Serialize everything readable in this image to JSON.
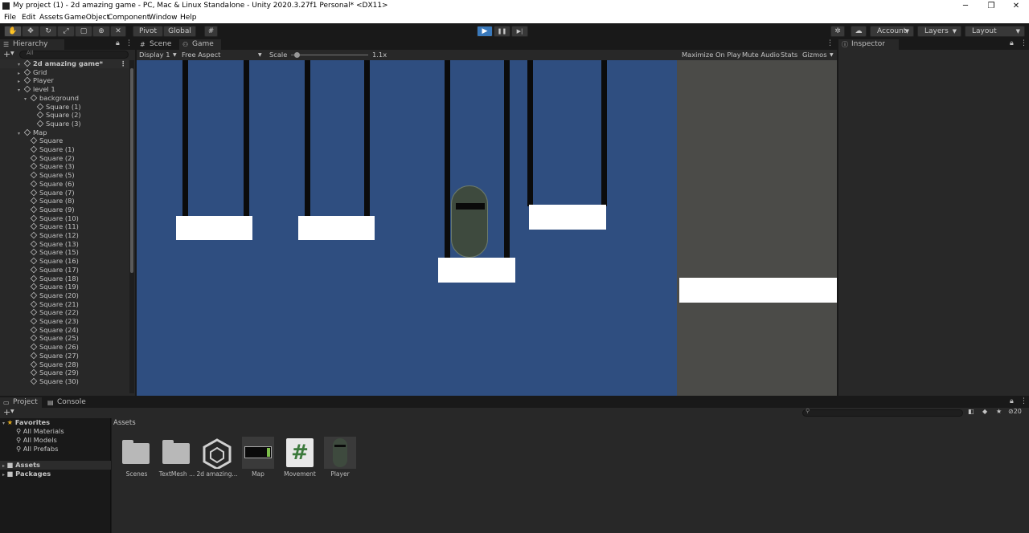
{
  "window": {
    "title": "My project (1) - 2d amazing game - PC, Mac & Linux Standalone - Unity 2020.3.27f1 Personal* <DX11>",
    "minimize": "─",
    "maximize": "❐",
    "close": "✕"
  },
  "menu": [
    "File",
    "Edit",
    "Assets",
    "GameObject",
    "Component",
    "Window",
    "Help"
  ],
  "toolbar": {
    "pivot": "Pivot",
    "global": "Global",
    "play": "▶",
    "pause": "❚❚",
    "step": "▶|",
    "account": "Account",
    "layers": "Layers",
    "layout": "Layout"
  },
  "hierarchy": {
    "tab": "Hierarchy",
    "search_placeholder": "All",
    "scene": "2d amazing game*",
    "items": [
      {
        "label": "Grid",
        "depth": 1,
        "arrow": "▸"
      },
      {
        "label": "Player",
        "depth": 1,
        "arrow": "▸"
      },
      {
        "label": "level 1",
        "depth": 1,
        "arrow": "▾"
      },
      {
        "label": "background",
        "depth": 2,
        "arrow": "▾"
      },
      {
        "label": "Square (1)",
        "depth": 3,
        "arrow": ""
      },
      {
        "label": "Square (2)",
        "depth": 3,
        "arrow": ""
      },
      {
        "label": "Square (3)",
        "depth": 3,
        "arrow": ""
      },
      {
        "label": "Map",
        "depth": 1,
        "arrow": "▾"
      },
      {
        "label": "Square",
        "depth": 2,
        "arrow": ""
      },
      {
        "label": "Square (1)",
        "depth": 2,
        "arrow": ""
      },
      {
        "label": "Square (2)",
        "depth": 2,
        "arrow": ""
      },
      {
        "label": "Square (3)",
        "depth": 2,
        "arrow": ""
      },
      {
        "label": "Square (5)",
        "depth": 2,
        "arrow": ""
      },
      {
        "label": "Square (6)",
        "depth": 2,
        "arrow": ""
      },
      {
        "label": "Square (7)",
        "depth": 2,
        "arrow": ""
      },
      {
        "label": "Square (8)",
        "depth": 2,
        "arrow": ""
      },
      {
        "label": "Square (9)",
        "depth": 2,
        "arrow": ""
      },
      {
        "label": "Square (10)",
        "depth": 2,
        "arrow": ""
      },
      {
        "label": "Square (11)",
        "depth": 2,
        "arrow": ""
      },
      {
        "label": "Square (12)",
        "depth": 2,
        "arrow": ""
      },
      {
        "label": "Square (13)",
        "depth": 2,
        "arrow": ""
      },
      {
        "label": "Square (15)",
        "depth": 2,
        "arrow": ""
      },
      {
        "label": "Square (16)",
        "depth": 2,
        "arrow": ""
      },
      {
        "label": "Square (17)",
        "depth": 2,
        "arrow": ""
      },
      {
        "label": "Square (18)",
        "depth": 2,
        "arrow": ""
      },
      {
        "label": "Square (19)",
        "depth": 2,
        "arrow": ""
      },
      {
        "label": "Square (20)",
        "depth": 2,
        "arrow": ""
      },
      {
        "label": "Square (21)",
        "depth": 2,
        "arrow": ""
      },
      {
        "label": "Square (22)",
        "depth": 2,
        "arrow": ""
      },
      {
        "label": "Square (23)",
        "depth": 2,
        "arrow": ""
      },
      {
        "label": "Square (24)",
        "depth": 2,
        "arrow": ""
      },
      {
        "label": "Square (25)",
        "depth": 2,
        "arrow": ""
      },
      {
        "label": "Square (26)",
        "depth": 2,
        "arrow": ""
      },
      {
        "label": "Square (27)",
        "depth": 2,
        "arrow": ""
      },
      {
        "label": "Square (28)",
        "depth": 2,
        "arrow": ""
      },
      {
        "label": "Square (29)",
        "depth": 2,
        "arrow": ""
      },
      {
        "label": "Square (30)",
        "depth": 2,
        "arrow": ""
      }
    ]
  },
  "center": {
    "tabs": [
      "Scene",
      "Game"
    ],
    "display": "Display 1",
    "aspect": "Free Aspect",
    "scale_label": "Scale",
    "scale_value": "1.1x",
    "maximize": "Maximize On Play",
    "mute": "Mute Audio",
    "stats": "Stats",
    "gizmos": "Gizmos"
  },
  "inspector": {
    "tab": "Inspector"
  },
  "bottom": {
    "tabs": [
      "Project",
      "Console"
    ],
    "favorites": "Favorites",
    "favorite_items": [
      "All Materials",
      "All Models",
      "All Prefabs"
    ],
    "roots": [
      "Assets",
      "Packages"
    ],
    "assets_header": "Assets",
    "hidden_count": "20",
    "assets": [
      {
        "label": "Scenes",
        "icon": "folder-icon"
      },
      {
        "label": "TextMesh ...",
        "icon": "folder-icon"
      },
      {
        "label": "2d amazing...",
        "icon": "unity-scene-icon"
      },
      {
        "label": "Map",
        "icon": "map-prefab-icon"
      },
      {
        "label": "Movement",
        "icon": "csharp-script-icon"
      },
      {
        "label": "Player",
        "icon": "player-prefab-icon"
      }
    ]
  },
  "colors": {
    "game_bg": "#2f4e80",
    "panel": "#282828",
    "play_active": "#3a79bb",
    "player": "#3e4a3e"
  }
}
